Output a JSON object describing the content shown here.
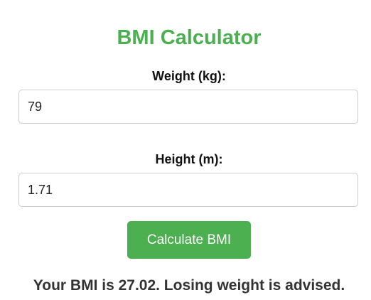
{
  "app": {
    "title": "BMI Calculator"
  },
  "form": {
    "weight": {
      "label": "Weight (kg):",
      "value": "79"
    },
    "height": {
      "label": "Height (m):",
      "value": "1.71"
    },
    "button_label": "Calculate BMI"
  },
  "result": {
    "text": "Your BMI is 27.02. Losing weight is advised."
  },
  "colors": {
    "accent": "#4caf50",
    "button_text": "#ffffff",
    "input_border": "#cccccc",
    "result_text": "#333333"
  }
}
